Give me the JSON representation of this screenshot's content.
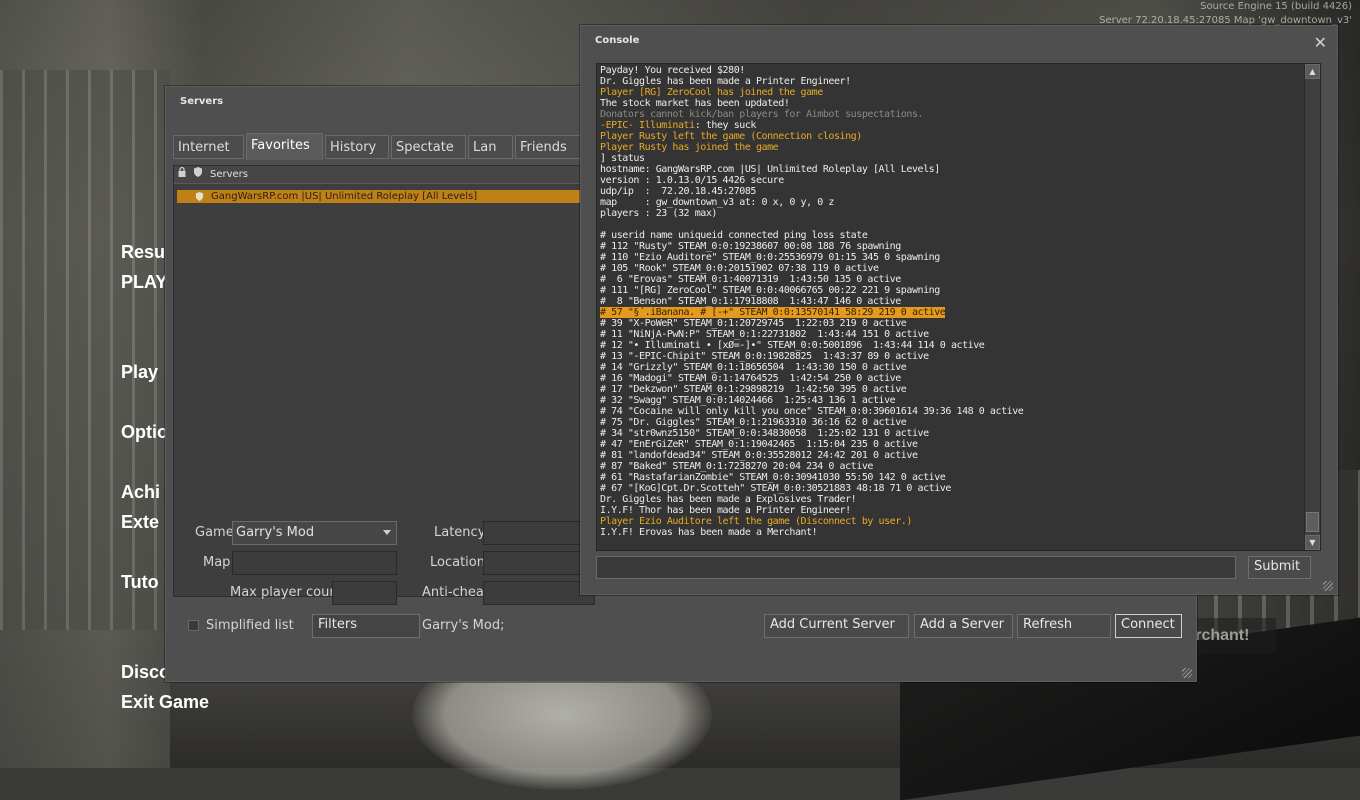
{
  "top_info": {
    "line1": "Source Engine 15 (build 4426)",
    "line2": "Server 72.20.18.45:27085 Map 'gw_downtown_v3'"
  },
  "main_menu": [
    {
      "label": "Resu",
      "key": "resume"
    },
    {
      "label": "PLAY",
      "key": "players"
    },
    {
      "label": "Play",
      "key": "play"
    },
    {
      "label": "Optio",
      "key": "options"
    },
    {
      "label": "Achi",
      "key": "achievements"
    },
    {
      "label": "Exte",
      "key": "extensions"
    },
    {
      "label": "Tuto",
      "key": "tutorial"
    },
    {
      "label": "Disco",
      "key": "disconnect"
    },
    {
      "label": "Exit Game",
      "key": "exit"
    }
  ],
  "chat_bubble": "I.Y.F! Erovas has been made a Merchant!",
  "servers": {
    "title": "Servers",
    "tabs": [
      "Internet",
      "Favorites",
      "History",
      "Spectate",
      "Lan",
      "Friends"
    ],
    "active_tab": "Favorites",
    "list_header": "Servers",
    "rows": [
      "GangWarsRP.com |US| Unlimited Roleplay [All Levels]"
    ],
    "filters": {
      "game_label": "Game",
      "game_value": "Garry's Mod",
      "map_label": "Map",
      "map_value": "",
      "max_player_label": "Max player count",
      "max_player_value": "",
      "latency_label": "Latency",
      "latency_value": "",
      "location_label": "Location",
      "location_value": "",
      "anticheat_label": "Anti-cheat",
      "anticheat_value": ""
    },
    "simplified_list_label": "Simplified list",
    "filters_button": "Filters",
    "filter_summary": "Garry's Mod;",
    "buttons": {
      "add_current": "Add Current Server",
      "add_server": "Add a Server",
      "refresh": "Refresh",
      "connect": "Connect"
    }
  },
  "console": {
    "title": "Console",
    "close_glyph": "✕",
    "submit_label": "Submit",
    "input_value": "",
    "lines": [
      {
        "t": "Payday! You received $280!",
        "c": "w"
      },
      {
        "t": "Dr. Giggles has been made a Printer Engineer!",
        "c": "w"
      },
      {
        "t": "Player [RG] ZeroCool has joined the game",
        "c": "y"
      },
      {
        "t": "The stock market has been updated!",
        "c": "w"
      },
      {
        "t": "Donators cannot kick/ban players for Aimbot suspectations.",
        "c": "g"
      },
      {
        "t": "-EPIC- Illuminati: they suck",
        "c": "mix",
        "a": "-EPIC- Illuminati",
        "b": ": they suck"
      },
      {
        "t": "Player Rusty left the game (Connection closing)",
        "c": "y"
      },
      {
        "t": "Player Rusty has joined the game",
        "c": "y"
      },
      {
        "t": "] status",
        "c": "w"
      },
      {
        "t": "hostname: GangWarsRP.com |US| Unlimited Roleplay [All Levels]",
        "c": "w"
      },
      {
        "t": "version : 1.0.13.0/15 4426 secure",
        "c": "w"
      },
      {
        "t": "udp/ip  :  72.20.18.45:27085",
        "c": "w"
      },
      {
        "t": "map     : gw_downtown_v3 at: 0 x, 0 y, 0 z",
        "c": "w"
      },
      {
        "t": "players : 23 (32 max)",
        "c": "w"
      },
      {
        "t": "",
        "c": "w"
      },
      {
        "t": "# userid name uniqueid connected ping loss state",
        "c": "w"
      },
      {
        "t": "# 112 \"Rusty\" STEAM_0:0:19238607 00:08 188 76 spawning",
        "c": "w"
      },
      {
        "t": "# 110 \"Ezio Auditore\" STEAM_0:0:25536979 01:15 345 0 spawning",
        "c": "w"
      },
      {
        "t": "# 105 \"Rook\" STEAM_0:0:20151902 07:38 119 0 active",
        "c": "w"
      },
      {
        "t": "#  6 \"Erovas\" STEAM_0:1:40071319  1:43:50 135 0 active",
        "c": "w"
      },
      {
        "t": "# 111 \"[RG] ZeroCool\" STEAM_0:0:40066765 00:22 221 9 spawning",
        "c": "w"
      },
      {
        "t": "#  8 \"Benson\" STEAM_0:1:17918808  1:43:47 146 0 active",
        "c": "w"
      },
      {
        "t": "# 57 \"§´.iBanana. # [-+\" STEAM_0:0:13570141 58:29 219 0 active",
        "c": "hl"
      },
      {
        "t": "# 39 \"X-PoWeR\" STEAM_0:1:20729745  1:22:03 219 0 active",
        "c": "w"
      },
      {
        "t": "# 11 \"NiNjA-PwN:P\" STEAM_0:1:22731802  1:43:44 151 0 active",
        "c": "w"
      },
      {
        "t": "# 12 \"• Illuminati • [xØ=-]•\" STEAM_0:0:5001896  1:43:44 114 0 active",
        "c": "w"
      },
      {
        "t": "# 13 \"-EPIC-Chipit\" STEAM_0:0:19828825  1:43:37 89 0 active",
        "c": "w"
      },
      {
        "t": "# 14 \"Grizzly\" STEAM_0:1:18656504  1:43:30 150 0 active",
        "c": "w"
      },
      {
        "t": "# 16 \"Madogi\" STEAM_0:1:14764525  1:42:54 250 0 active",
        "c": "w"
      },
      {
        "t": "# 17 \"Dekzwon\" STEAM_0:1:29898219  1:42:50 395 0 active",
        "c": "w"
      },
      {
        "t": "# 32 \"Swagg\" STEAM_0:0:14024466  1:25:43 136 1 active",
        "c": "w"
      },
      {
        "t": "# 74 \"Cocaine will only kill you once\" STEAM_0:0:39601614 39:36 148 0 active",
        "c": "w"
      },
      {
        "t": "# 75 \"Dr. Giggles\" STEAM_0:1:21963310 36:16 62 0 active",
        "c": "w"
      },
      {
        "t": "# 34 \"str0wnz5150\" STEAM_0:0:34830058  1:25:02 131 0 active",
        "c": "w"
      },
      {
        "t": "# 47 \"EnErGiZeR\" STEAM_0:1:19042465  1:15:04 235 0 active",
        "c": "w"
      },
      {
        "t": "# 81 \"landofdead34\" STEAM_0:0:35528012 24:42 201 0 active",
        "c": "w"
      },
      {
        "t": "# 87 \"Baked\" STEAM_0:1:7238270 20:04 234 0 active",
        "c": "w"
      },
      {
        "t": "# 61 \"RastafarianZombie\" STEAM_0:0:30941030 55:50 142 0 active",
        "c": "w"
      },
      {
        "t": "# 67 \"[KoG]Cpt.Dr.Scotteh\" STEAM_0:0:30521883 48:18 71 0 active",
        "c": "w"
      },
      {
        "t": "Dr. Giggles has been made a Explosives Trader!",
        "c": "w"
      },
      {
        "t": "I.Y.F! Thor has been made a Printer Engineer!",
        "c": "w"
      },
      {
        "t": "Player Ezio Auditore left the game (Disconnect by user.)",
        "c": "y"
      },
      {
        "t": "I.Y.F! Erovas has been made a Merchant!",
        "c": "w"
      }
    ]
  },
  "colors": {
    "highlight": "#e49a1e",
    "player_msg": "#e9a925",
    "admin_msg": "#8a8a85",
    "selected_row": "#c08018"
  }
}
